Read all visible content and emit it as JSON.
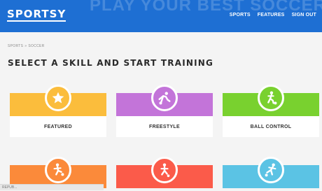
{
  "header": {
    "logo": "SPORTSY",
    "faint_headline": "PLAY YOUR BEST SOCCER",
    "nav": [
      "SPORTS",
      "FEATURES",
      "SIGN OUT"
    ]
  },
  "breadcrumb": {
    "items": [
      "SPORTS",
      "SOCCER"
    ],
    "separator": "»"
  },
  "title": "SELECT A SKILL AND START TRAINING",
  "cards": [
    {
      "label": "FEATURED",
      "color": "#fbbd3c",
      "icon": "star-icon"
    },
    {
      "label": "FREESTYLE",
      "color": "#c374d9",
      "icon": "freestyle-player-icon"
    },
    {
      "label": "BALL CONTROL",
      "color": "#79d12f",
      "icon": "ball-control-player-icon"
    },
    {
      "label": "",
      "color": "#fb8a3a",
      "icon": "dribble-player-icon"
    },
    {
      "label": "",
      "color": "#fb5b4a",
      "icon": "running-player-icon"
    },
    {
      "label": "",
      "color": "#5bc3e4",
      "icon": "kick-player-icon"
    }
  ],
  "status_bar": {
    "text": "REPUB..."
  },
  "colors": {
    "header": "#1e6fd3",
    "background": "#f4f4f4"
  }
}
